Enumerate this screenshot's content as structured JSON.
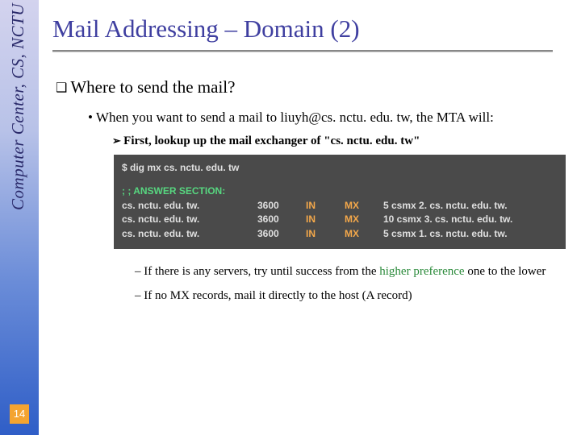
{
  "sidebar": {
    "label": "Computer Center, CS, NCTU"
  },
  "page_number": "14",
  "title": "Mail Addressing – Domain (2)",
  "q1": "Where to send the mail?",
  "b1": "When you want to send a mail to liuyh@cs. nctu. edu. tw, the MTA will:",
  "a1_prefix": "First, lookup up the mail exchanger of ",
  "a1_quoted": "\"cs. nctu. edu. tw\"",
  "terminal": {
    "cmd": "$ dig mx cs. nctu. edu. tw",
    "answer_header": "; ; ANSWER SECTION:",
    "rows": [
      {
        "name": "cs. nctu. edu. tw.",
        "ttl": "3600",
        "cls": "IN",
        "type": "MX",
        "data": "5 csmx 2. cs. nctu. edu. tw."
      },
      {
        "name": "cs. nctu. edu. tw.",
        "ttl": "3600",
        "cls": "IN",
        "type": "MX",
        "data": "10 csmx 3. cs. nctu. edu. tw."
      },
      {
        "name": "cs. nctu. edu. tw.",
        "ttl": "3600",
        "cls": "IN",
        "type": "MX",
        "data": "5 csmx 1. cs. nctu. edu. tw."
      }
    ]
  },
  "note1_a": "If there is any servers, try until success from the ",
  "note1_hl": "higher preference",
  "note1_b": " one to the lower",
  "note2": "If no MX records, mail it directly to the host (A record)"
}
